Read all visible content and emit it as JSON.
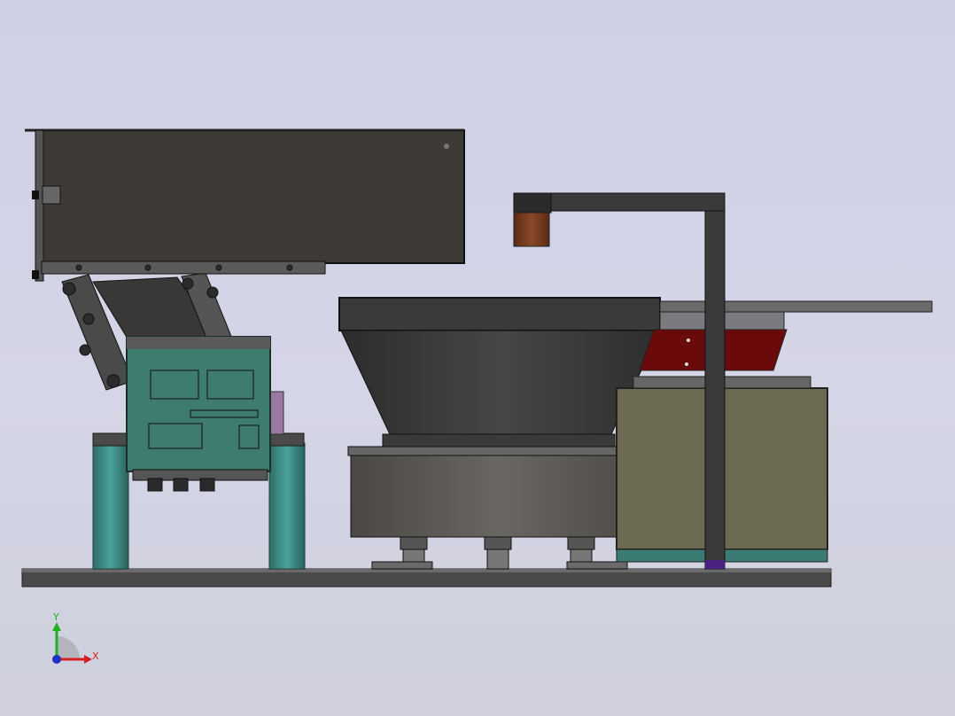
{
  "triad": {
    "x_label": "X",
    "y_label": "Y",
    "x_color": "#d42020",
    "y_color": "#20b020",
    "z_color": "#2030c0"
  },
  "colors": {
    "background": "#d2d3e6",
    "hopper_dark": "#3d3a36",
    "panel_teal": "#3e7c70",
    "leg_teal": "#3c8a84",
    "bowl_body": "#3a3a3a",
    "base_bowl": "#57544f",
    "cabinet_olive": "#6c6a52",
    "linear_red": "#6a0a0a",
    "arm_frame": "#3a3a3a"
  }
}
